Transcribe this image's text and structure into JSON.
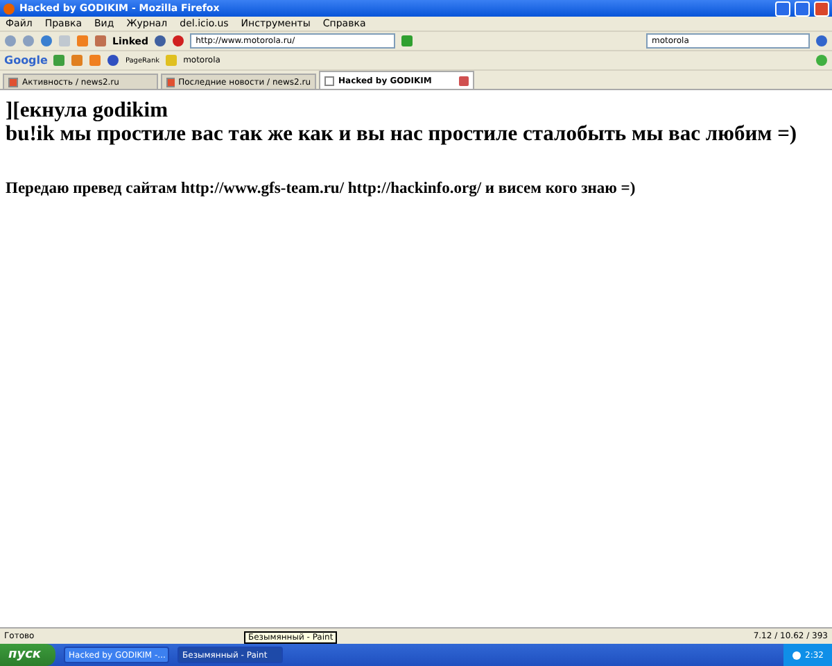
{
  "window": {
    "title": "Hacked by GODIKIM - Mozilla Firefox"
  },
  "menu": [
    "Файл",
    "Правка",
    "Вид",
    "Журнал",
    "del.icio.us",
    "Инструменты",
    "Справка"
  ],
  "nav": {
    "linkedin": "Linked",
    "address": "http://www.motorola.ru/",
    "search": "motorola"
  },
  "google_bar": {
    "logo": "Google",
    "pagerank": "PageRank",
    "query": "motorola"
  },
  "tabs": [
    {
      "label": "Активность / news2.ru",
      "selected": false
    },
    {
      "label": "Последние новости / news2.ru",
      "selected": false
    },
    {
      "label": "Hacked by GODIKIM",
      "selected": true
    }
  ],
  "content": {
    "headings": [
      "][екнула godikim",
      "bu!ik мы простиле вас так же как и вы нас простиле сталобыть мы вас любим =)"
    ],
    "paragraph": "Передаю превед сайтам http://www.gfs-team.ru/ http://hackinfo.org/ и висем кого знаю =)"
  },
  "status_bar": {
    "text": "Готово",
    "stats": "7.12 / 10.62 / 393"
  },
  "tooltip": "Безымянный - Paint",
  "taskbar": {
    "start": "пуск",
    "tasks": [
      {
        "label": "Hacked by GODIKIM -...",
        "selected": false
      },
      {
        "label": "Безымянный - Paint",
        "selected": true
      }
    ],
    "clock": "2:32"
  }
}
